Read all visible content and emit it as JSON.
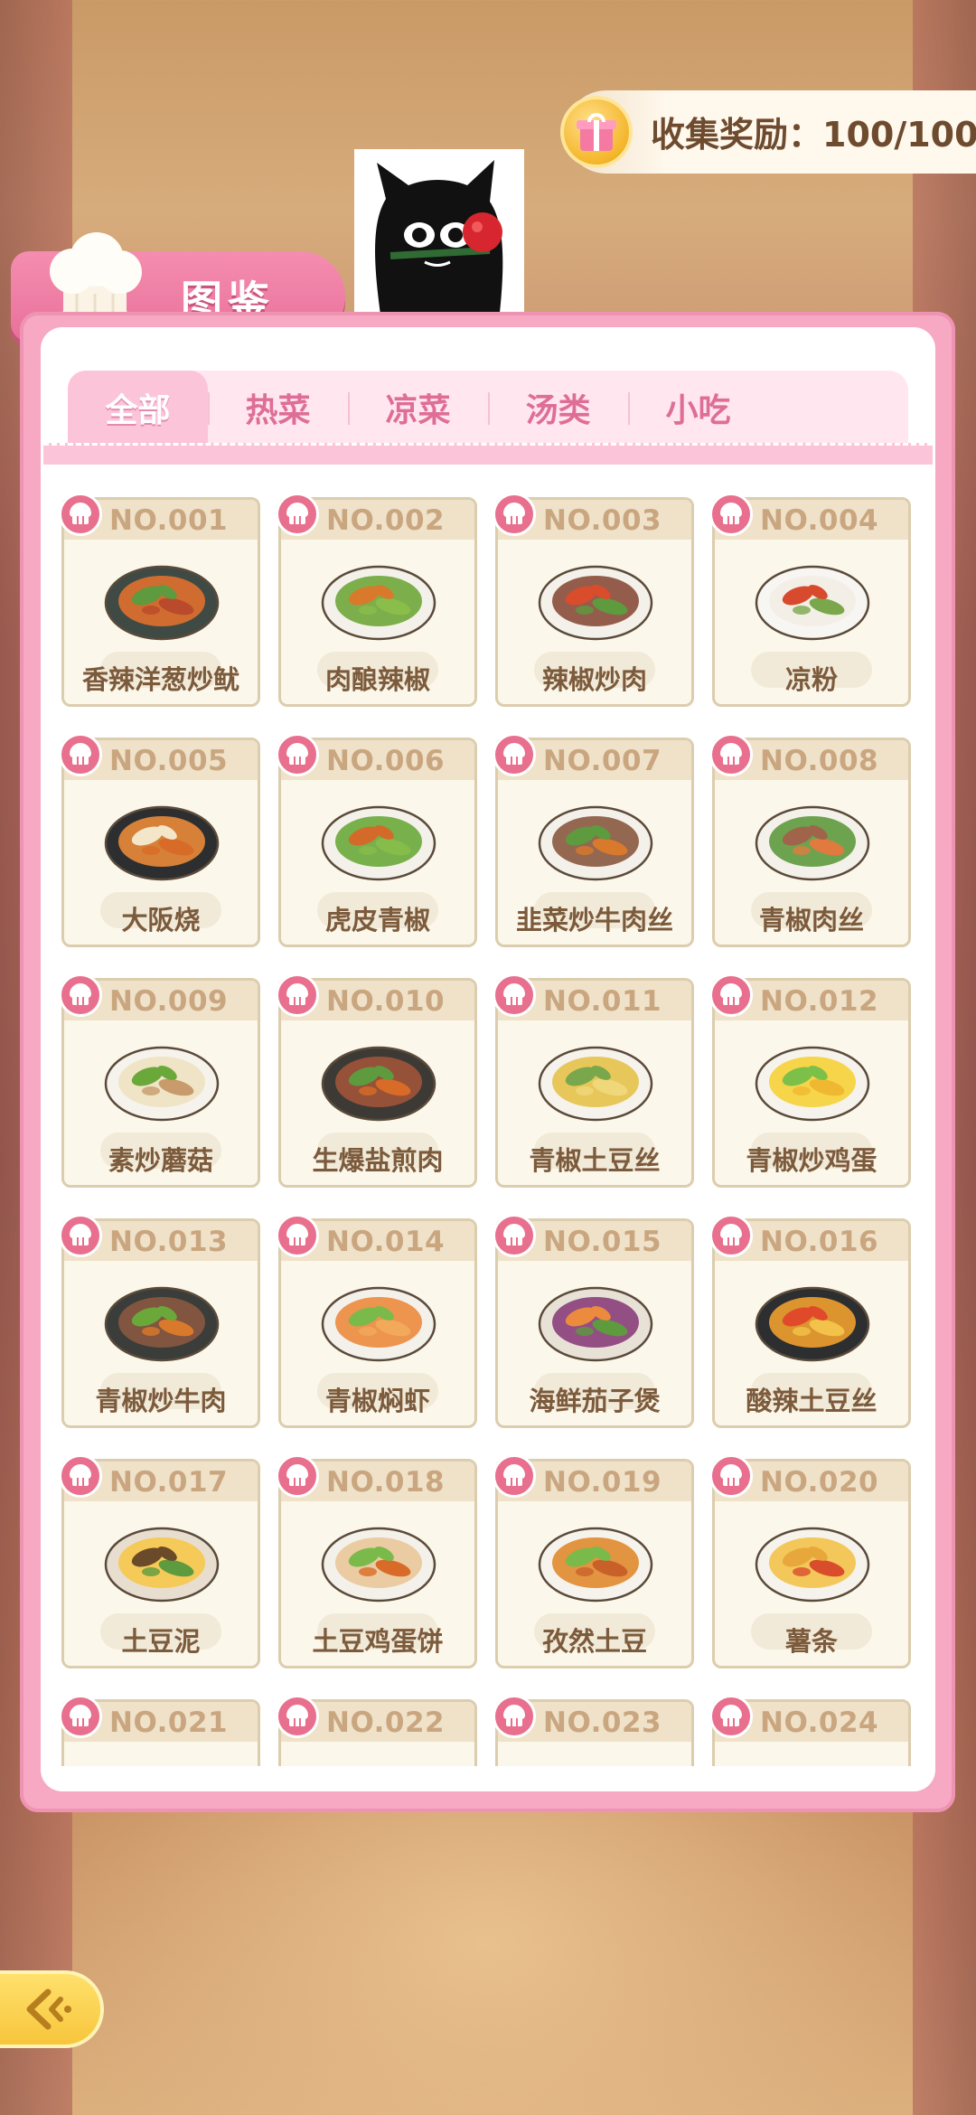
{
  "reward": {
    "label": "收集奖励：100/100",
    "icon": "gift-icon"
  },
  "title": {
    "text": "图鉴",
    "icon": "chef-hat-icon"
  },
  "tabs": [
    {
      "label": "全部",
      "active": true
    },
    {
      "label": "热菜",
      "active": false
    },
    {
      "label": "凉菜",
      "active": false
    },
    {
      "label": "汤类",
      "active": false
    },
    {
      "label": "小吃",
      "active": false
    }
  ],
  "dishes": [
    {
      "no": "NO.001",
      "name": "香辣洋葱炒鱿",
      "plate": "#3f4a45",
      "food": [
        "#e0702e",
        "#5e9a3e",
        "#b94a2b"
      ]
    },
    {
      "no": "NO.002",
      "name": "肉酿辣椒",
      "plate": "#f4f1ea",
      "food": [
        "#6fa73a",
        "#d9792b",
        "#8bbd4b"
      ]
    },
    {
      "no": "NO.003",
      "name": "辣椒炒肉",
      "plate": "#f4f1ea",
      "food": [
        "#8a4c3a",
        "#d94c2c",
        "#5e9a3e"
      ]
    },
    {
      "no": "NO.004",
      "name": "凉粉",
      "plate": "#f8f6f2",
      "food": [
        "#f3eee4",
        "#d84a2d",
        "#7aa74c"
      ]
    },
    {
      "no": "NO.005",
      "name": "大阪烧",
      "plate": "#2c2e30",
      "food": [
        "#e98a3a",
        "#f3e6c9",
        "#d86b27"
      ]
    },
    {
      "no": "NO.006",
      "name": "虎皮青椒",
      "plate": "#f4f1ea",
      "food": [
        "#6aa83a",
        "#d46a2a",
        "#86bd4a"
      ]
    },
    {
      "no": "NO.007",
      "name": "韭菜炒牛肉丝",
      "plate": "#f4f1ea",
      "food": [
        "#8a5840",
        "#5e9a3e",
        "#d9792b"
      ]
    },
    {
      "no": "NO.008",
      "name": "青椒肉丝",
      "plate": "#f4f1ea",
      "food": [
        "#5e9a3e",
        "#a0644a",
        "#e07a3e"
      ]
    },
    {
      "no": "NO.009",
      "name": "素炒蘑菇",
      "plate": "#f6f3ec",
      "food": [
        "#efe2c2",
        "#6aa83a",
        "#c79b6b"
      ]
    },
    {
      "no": "NO.010",
      "name": "生爆盐煎肉",
      "plate": "#3d3a36",
      "food": [
        "#a0543a",
        "#5e9a3e",
        "#d86b27"
      ]
    },
    {
      "no": "NO.011",
      "name": "青椒土豆丝",
      "plate": "#f6f3ec",
      "food": [
        "#e6c24a",
        "#7aa74c",
        "#f0d77a"
      ]
    },
    {
      "no": "NO.012",
      "name": "青椒炒鸡蛋",
      "plate": "#f6f3ec",
      "food": [
        "#f6d23a",
        "#7cc04a",
        "#f0b830"
      ]
    },
    {
      "no": "NO.013",
      "name": "青椒炒牛肉",
      "plate": "#3a3d3a",
      "food": [
        "#8a5840",
        "#6aa83a",
        "#d9792b"
      ]
    },
    {
      "no": "NO.014",
      "name": "青椒焖虾",
      "plate": "#f4f1ea",
      "food": [
        "#ec8a3e",
        "#7aba4a",
        "#f3a95a"
      ]
    },
    {
      "no": "NO.015",
      "name": "海鲜茄子煲",
      "plate": "#e8e2d6",
      "food": [
        "#8a3f7a",
        "#ec8a3e",
        "#5e9a3e"
      ]
    },
    {
      "no": "NO.016",
      "name": "酸辣土豆丝",
      "plate": "#2c2e30",
      "food": [
        "#f0a030",
        "#e04a2a",
        "#f3c24a"
      ]
    },
    {
      "no": "NO.017",
      "name": "土豆泥",
      "plate": "#e8ded0",
      "food": [
        "#f6c84a",
        "#6b4a2a",
        "#5e9a3e"
      ]
    },
    {
      "no": "NO.018",
      "name": "土豆鸡蛋饼",
      "plate": "#f4f1ea",
      "food": [
        "#e9c79a",
        "#7aba4a",
        "#d86b27"
      ]
    },
    {
      "no": "NO.019",
      "name": "孜然土豆",
      "plate": "#f6f3ec",
      "food": [
        "#e08a2e",
        "#7aba4a",
        "#c9602a"
      ]
    },
    {
      "no": "NO.020",
      "name": "薯条",
      "plate": "#f6f3ec",
      "food": [
        "#f3c24a",
        "#e8a73a",
        "#d94c2c"
      ]
    },
    {
      "no": "NO.021",
      "name": "",
      "plate": "#f4f1ea",
      "food": [
        "#cccccc",
        "#bbbbbb",
        "#aaaaaa"
      ]
    },
    {
      "no": "NO.022",
      "name": "",
      "plate": "#f4f1ea",
      "food": [
        "#cccccc",
        "#bbbbbb",
        "#aaaaaa"
      ]
    },
    {
      "no": "NO.023",
      "name": "",
      "plate": "#f4f1ea",
      "food": [
        "#cccccc",
        "#bbbbbb",
        "#aaaaaa"
      ]
    },
    {
      "no": "NO.024",
      "name": "",
      "plate": "#f4f1ea",
      "food": [
        "#cccccc",
        "#bbbbbb",
        "#aaaaaa"
      ]
    }
  ],
  "back": {
    "icon": "back-arrow-icon"
  },
  "colors": {
    "accent_pink": "#f7a9c4",
    "tab_text": "#de6e96",
    "card_text": "#7c5a3c",
    "card_no": "#c9a67f"
  }
}
